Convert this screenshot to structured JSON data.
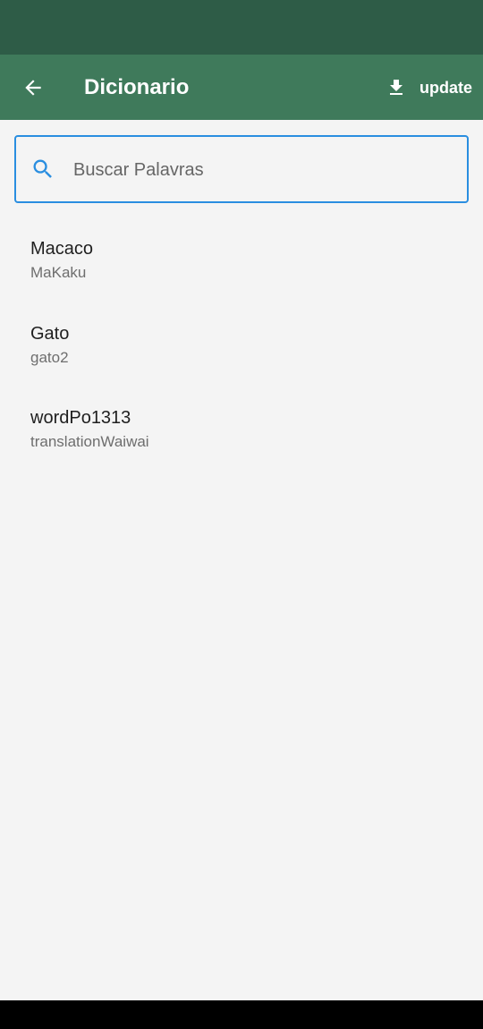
{
  "app_bar": {
    "title": "Dicionario",
    "update_label": "update"
  },
  "search": {
    "placeholder": "Buscar Palavras",
    "value": ""
  },
  "words": [
    {
      "word": "Macaco",
      "translation": "MaKaku"
    },
    {
      "word": "Gato",
      "translation": "gato2"
    },
    {
      "word": "wordPo1313",
      "translation": "translationWaiwai"
    }
  ],
  "icons": {
    "back": "arrow-back-icon",
    "update": "download-icon",
    "search": "search-icon"
  },
  "colors": {
    "status_bar": "#2e5c47",
    "app_bar": "#3f7a5b",
    "accent": "#2a8ee0",
    "background": "#f4f4f4"
  }
}
